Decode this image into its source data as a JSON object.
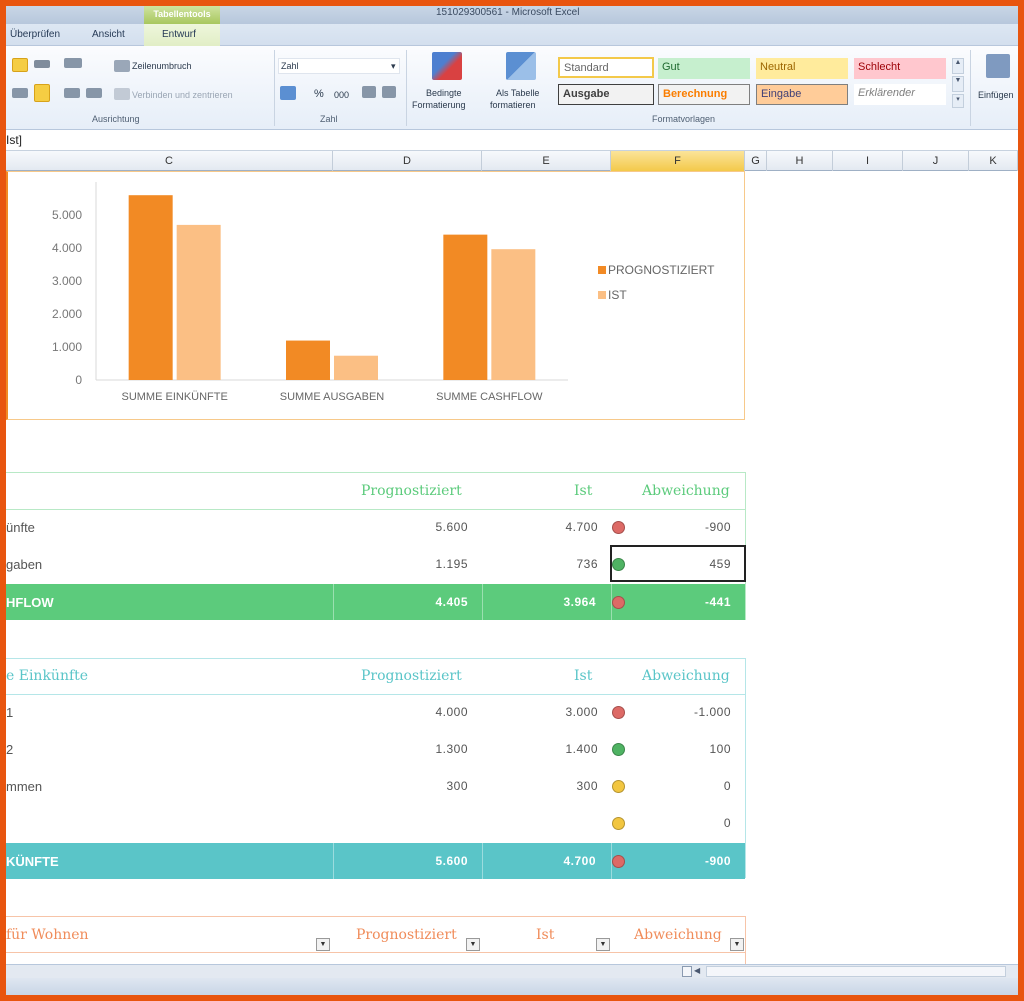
{
  "window": {
    "title": "151029300561 - Microsoft Excel",
    "context_group": "Tabellentools"
  },
  "tabs": [
    "Überprüfen",
    "Ansicht",
    "Entwurf"
  ],
  "ribbon": {
    "wrap_label": "Zeilenumbruch",
    "merge_label": "Verbinden und zentrieren",
    "align_group": "Ausrichtung",
    "number_format": "Zahl",
    "number_group": "Zahl",
    "percent": "%",
    "thousands": "000",
    "cond_format": [
      "Bedingte",
      "Formatierung"
    ],
    "as_table": [
      "Als Tabelle",
      "formatieren"
    ],
    "styles_group": "Formatvorlagen",
    "insert_label": "Einfügen",
    "styles": {
      "standard": "Standard",
      "gut": "Gut",
      "neutral": "Neutral",
      "schlecht": "Schlecht",
      "ausgabe": "Ausgabe",
      "berechnung": "Berechnung",
      "eingabe": "Eingabe",
      "erklaerend": "Erklärender"
    }
  },
  "formula_bar": {
    "text": "Ist]"
  },
  "columns": [
    "C",
    "D",
    "E",
    "F",
    "G",
    "H",
    "I",
    "J",
    "K"
  ],
  "chart_data": {
    "type": "bar",
    "categories": [
      "SUMME EINKÜNFTE",
      "SUMME AUSGABEN",
      "SUMME CASHFLOW"
    ],
    "series": [
      {
        "name": "PROGNOSTIZIERT",
        "values": [
          5600,
          1195,
          4405
        ],
        "color": "#f28a24"
      },
      {
        "name": "IST",
        "values": [
          4700,
          736,
          3964
        ],
        "color": "#fbbf84"
      }
    ],
    "yticks": [
      "0",
      "1.000",
      "2.000",
      "3.000",
      "4.000",
      "5.000"
    ],
    "ylim": [
      0,
      6000
    ],
    "legend": "right"
  },
  "table1": {
    "headers": [
      "Prognostiziert",
      "Ist",
      "Abweichung"
    ],
    "rows": [
      {
        "label": "ünfte",
        "prog": "5.600",
        "ist": "4.700",
        "dev": "-900",
        "status": "#dd6a66"
      },
      {
        "label": "gaben",
        "prog": "1.195",
        "ist": "736",
        "dev": "459",
        "status": "#4fb363"
      }
    ],
    "total": {
      "label": "HFLOW",
      "prog": "4.405",
      "ist": "3.964",
      "dev": "-441",
      "status": "#dd6a66"
    },
    "color": "#5ccb7c"
  },
  "table2": {
    "title": "e Einkünfte",
    "headers": [
      "Prognostiziert",
      "Ist",
      "Abweichung"
    ],
    "rows": [
      {
        "label": "1",
        "prog": "4.000",
        "ist": "3.000",
        "dev": "-1.000",
        "status": "#dd6a66"
      },
      {
        "label": "2",
        "prog": "1.300",
        "ist": "1.400",
        "dev": "100",
        "status": "#4fb363"
      },
      {
        "label": "mmen",
        "prog": "300",
        "ist": "300",
        "dev": "0",
        "status": "#f2c640"
      },
      {
        "label": "",
        "prog": "",
        "ist": "",
        "dev": "0",
        "status": "#f2c640"
      }
    ],
    "total": {
      "label": "KÜNFTE",
      "prog": "5.600",
      "ist": "4.700",
      "dev": "-900",
      "status": "#dd6a66"
    },
    "color": "#5ac5c8"
  },
  "table3": {
    "title": "für Wohnen",
    "headers": [
      "Prognostiziert",
      "Ist",
      "Abweichung"
    ],
    "color": "#f08c5a"
  }
}
